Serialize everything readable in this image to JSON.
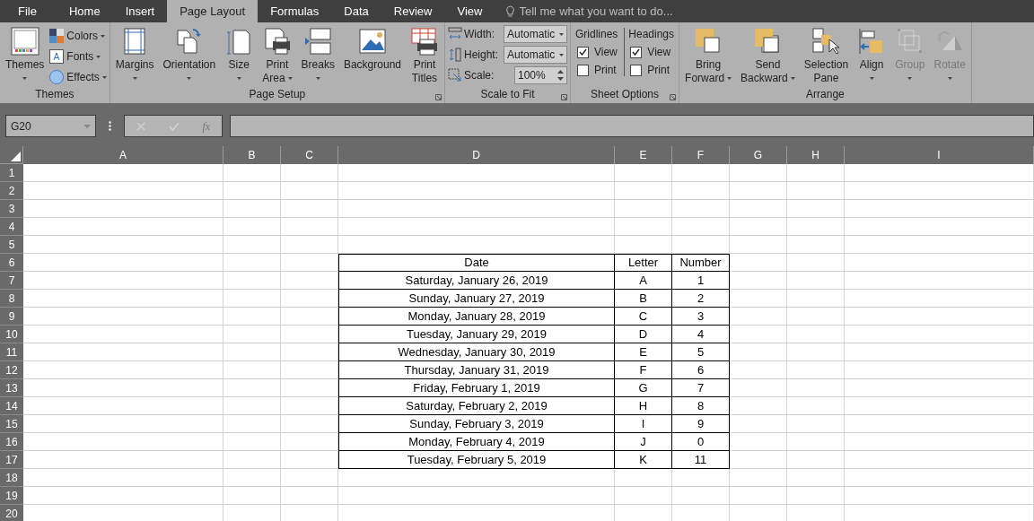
{
  "tabs": [
    {
      "label": "File",
      "selected": false
    },
    {
      "label": "Home",
      "selected": false
    },
    {
      "label": "Insert",
      "selected": false
    },
    {
      "label": "Page Layout",
      "selected": true
    },
    {
      "label": "Formulas",
      "selected": false
    },
    {
      "label": "Data",
      "selected": false
    },
    {
      "label": "Review",
      "selected": false
    },
    {
      "label": "View",
      "selected": false
    }
  ],
  "tell_me": {
    "placeholder": "Tell me what you want to do..."
  },
  "ribbon": {
    "groups": [
      {
        "kind": "themes",
        "label": "Themes",
        "launcher": false,
        "buttons": [
          {
            "lines": [
              "Themes"
            ],
            "dropdown": true,
            "disabled": false
          }
        ],
        "small": [
          {
            "label": "Colors",
            "dropdown": true
          },
          {
            "label": "Fonts",
            "dropdown": true
          },
          {
            "label": "Effects",
            "dropdown": true
          }
        ]
      },
      {
        "kind": "large",
        "label": "Page Setup",
        "launcher": true,
        "buttons": [
          {
            "lines": [
              "Margins"
            ],
            "dropdown": true,
            "disabled": false
          },
          {
            "lines": [
              "Orientation"
            ],
            "dropdown": true,
            "disabled": false
          },
          {
            "lines": [
              "Size"
            ],
            "dropdown": true,
            "disabled": false
          },
          {
            "lines": [
              "Print",
              "Area"
            ],
            "dropdown": true,
            "disabled": false
          },
          {
            "lines": [
              "Breaks"
            ],
            "dropdown": true,
            "disabled": false
          },
          {
            "lines": [
              "Background"
            ],
            "dropdown": false,
            "disabled": false
          },
          {
            "lines": [
              "Print",
              "Titles"
            ],
            "dropdown": false,
            "disabled": false
          }
        ]
      },
      {
        "kind": "scale",
        "label": "Scale to Fit",
        "launcher": true,
        "fields": [
          {
            "label": "Width:",
            "value": "Automatic",
            "kind": "dropdown"
          },
          {
            "label": "Height:",
            "value": "Automatic",
            "kind": "dropdown"
          },
          {
            "label": "Scale:",
            "value": "100%",
            "kind": "spinner"
          }
        ]
      },
      {
        "kind": "sheet_options",
        "label": "Sheet Options",
        "launcher": true,
        "columns": [
          {
            "heading": "Gridlines",
            "options": [
              {
                "label": "View",
                "checked": true
              },
              {
                "label": "Print",
                "checked": false
              }
            ]
          },
          {
            "heading": "Headings",
            "options": [
              {
                "label": "View",
                "checked": true
              },
              {
                "label": "Print",
                "checked": false
              }
            ]
          }
        ]
      },
      {
        "kind": "large",
        "label": "Arrange",
        "launcher": false,
        "buttons": [
          {
            "lines": [
              "Bring",
              "Forward"
            ],
            "dropdown": true,
            "disabled": false
          },
          {
            "lines": [
              "Send",
              "Backward"
            ],
            "dropdown": true,
            "disabled": false
          },
          {
            "lines": [
              "Selection",
              "Pane"
            ],
            "dropdown": false,
            "disabled": false
          },
          {
            "lines": [
              "Align"
            ],
            "dropdown": true,
            "disabled": false
          },
          {
            "lines": [
              "Group"
            ],
            "dropdown": true,
            "disabled": true
          },
          {
            "lines": [
              "Rotate"
            ],
            "dropdown": true,
            "disabled": true
          }
        ]
      }
    ]
  },
  "formula_bar": {
    "name_box": "G20",
    "fx": "fx"
  },
  "sheet": {
    "columns": [
      "A",
      "B",
      "C",
      "D",
      "E",
      "F",
      "G",
      "H",
      "I"
    ],
    "rows": [
      "1",
      "2",
      "3",
      "4",
      "5",
      "6",
      "7",
      "8",
      "9",
      "10",
      "11",
      "12",
      "13",
      "14",
      "15",
      "16",
      "17",
      "18",
      "19",
      "20"
    ],
    "table": {
      "columns": [
        "Date",
        "Letter",
        "Number"
      ],
      "rows": [
        [
          "Saturday, January 26, 2019",
          "A",
          "1"
        ],
        [
          "Sunday, January 27, 2019",
          "B",
          "2"
        ],
        [
          "Monday, January 28, 2019",
          "C",
          "3"
        ],
        [
          "Tuesday, January 29, 2019",
          "D",
          "4"
        ],
        [
          "Wednesday, January 30, 2019",
          "E",
          "5"
        ],
        [
          "Thursday, January 31, 2019",
          "F",
          "6"
        ],
        [
          "Friday, February 1, 2019",
          "G",
          "7"
        ],
        [
          "Saturday, February 2, 2019",
          "H",
          "8"
        ],
        [
          "Sunday, February 3, 2019",
          "I",
          "9"
        ],
        [
          "Monday, February 4, 2019",
          "J",
          "0"
        ],
        [
          "Tuesday, February 5, 2019",
          "K",
          "11"
        ]
      ]
    }
  }
}
